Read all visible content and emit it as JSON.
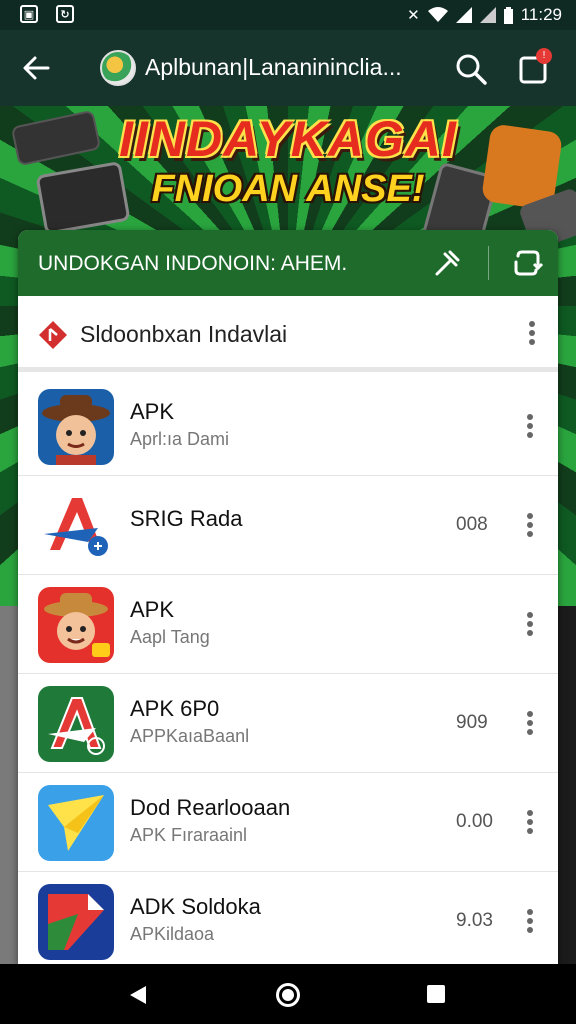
{
  "status_bar": {
    "time": "11:29",
    "left_icons": [
      "notification-icon",
      "sync-icon"
    ],
    "right_icons": [
      "nfc-icon",
      "wifi-icon",
      "signal-icon",
      "signal-icon",
      "battery-icon"
    ]
  },
  "app_bar": {
    "title": "Aplbunan|Lananininclia...",
    "cart_badge": "!"
  },
  "banner": {
    "title_line1": "IINDAYKAGAI",
    "title_line2": "FNIOAN ANSE!"
  },
  "card_header": {
    "title": "UNDOKGAN INDONOIN:  AHEM."
  },
  "list_header": {
    "title": "Sldoonbxan Indavlai"
  },
  "apps": [
    {
      "name": "APK",
      "subtitle": "Aprl:ıa Dami",
      "size": ""
    },
    {
      "name": "SRIG Rada",
      "subtitle": "",
      "size": "008"
    },
    {
      "name": "APK",
      "subtitle": "Aapl Tang",
      "size": ""
    },
    {
      "name": "APK 6P0",
      "subtitle": "APPKaıaBaanl",
      "size": "909"
    },
    {
      "name": "Dod Rearlooaan",
      "subtitle": "APK Fıraraainl",
      "size": "0.00"
    },
    {
      "name": "ADK Soldoka",
      "subtitle": "APKildaoa",
      "size": "9.03"
    }
  ],
  "colors": {
    "app_bar": "#16342c",
    "card_header": "#1f6b2c",
    "accent_red": "#e62b1f",
    "accent_yellow": "#ffd21f"
  }
}
